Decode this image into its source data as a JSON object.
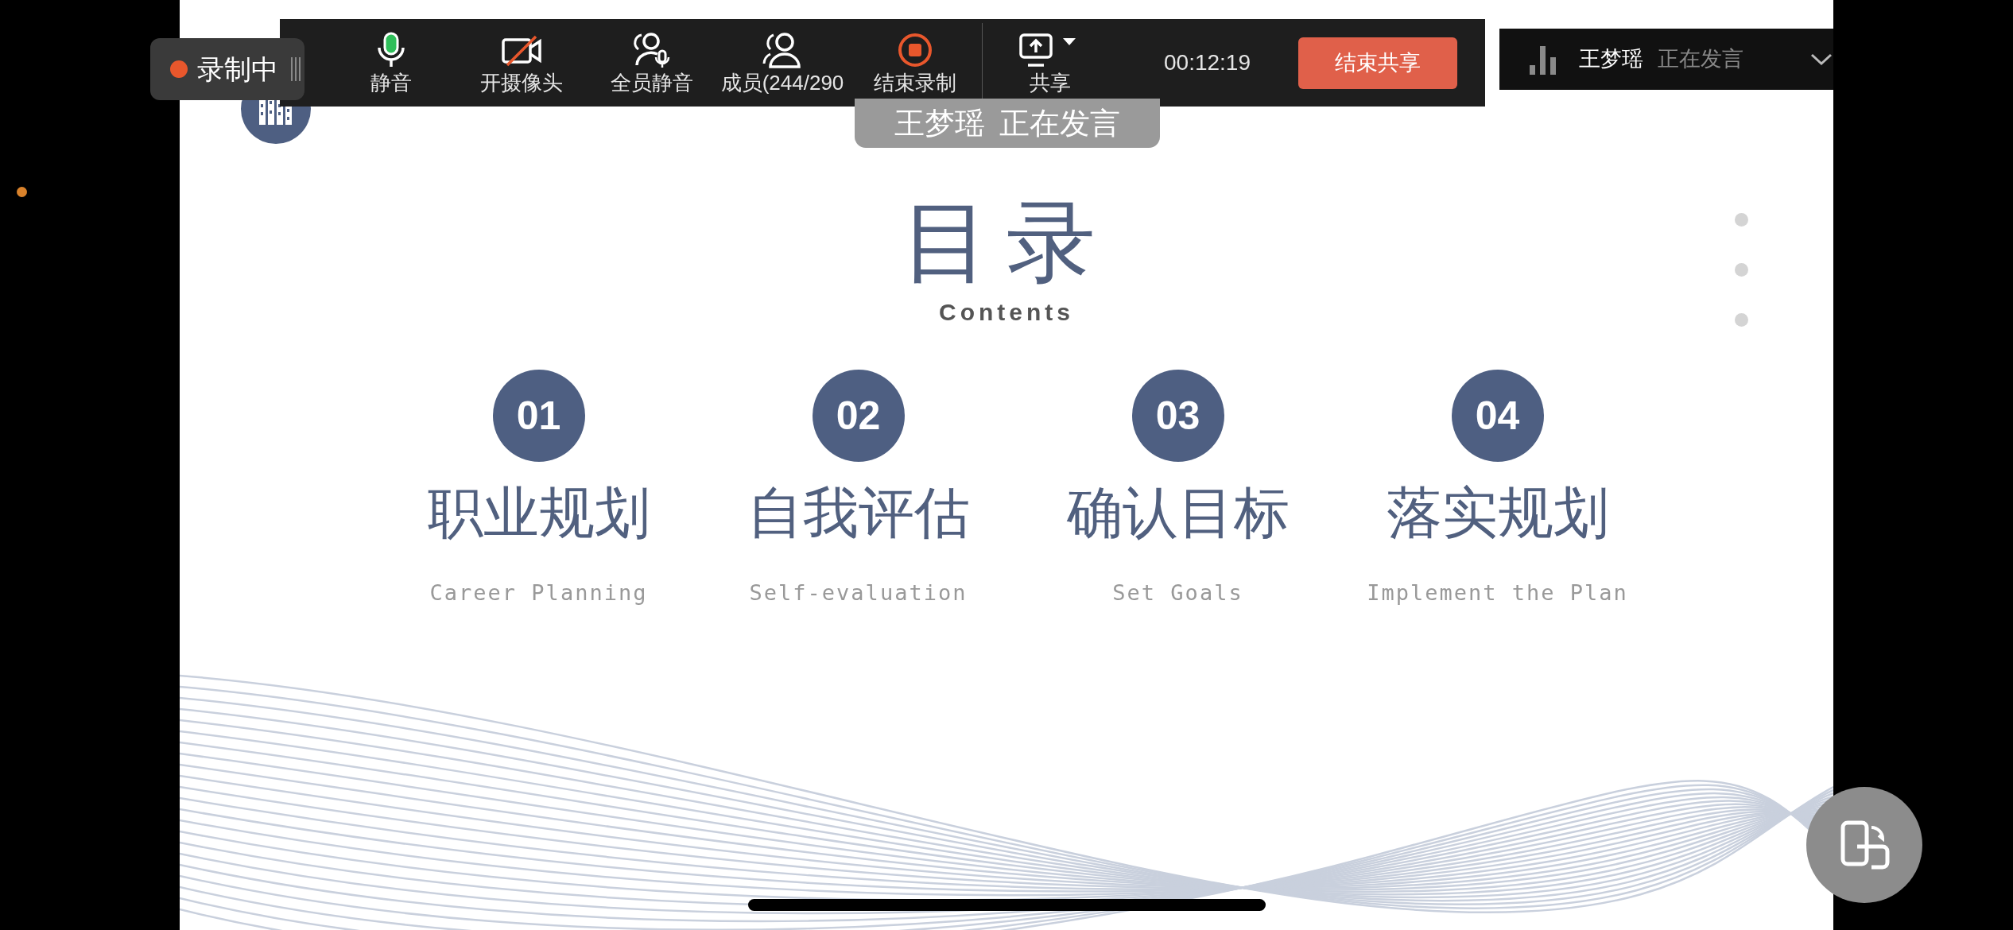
{
  "recording": {
    "label": "录制中"
  },
  "toolbar": {
    "buttons": [
      {
        "kind": "mic",
        "label": "静音"
      },
      {
        "kind": "camera-off",
        "label": "开摄像头"
      },
      {
        "kind": "mute-all",
        "label": "全员静音"
      },
      {
        "kind": "members",
        "label": "成员(244/290"
      },
      {
        "kind": "stop-record",
        "label": "结束录制"
      },
      {
        "kind": "share",
        "label": "共享"
      }
    ],
    "timer": "00:12:19",
    "end_share": "结束共享"
  },
  "speaker_panel": {
    "name": "王梦瑶",
    "status": "正在发言"
  },
  "toast": {
    "name": "王梦瑶",
    "status": "正在发言"
  },
  "slide": {
    "title": "目录",
    "subtitle": "Contents",
    "items": [
      {
        "number": "01",
        "title": "职业规划",
        "subtitle": "Career Planning"
      },
      {
        "number": "02",
        "title": "自我评估",
        "subtitle": "Self-evaluation"
      },
      {
        "number": "03",
        "title": "确认目标",
        "subtitle": "Set Goals"
      },
      {
        "number": "04",
        "title": "落实规划",
        "subtitle": "Implement the Plan"
      }
    ]
  }
}
